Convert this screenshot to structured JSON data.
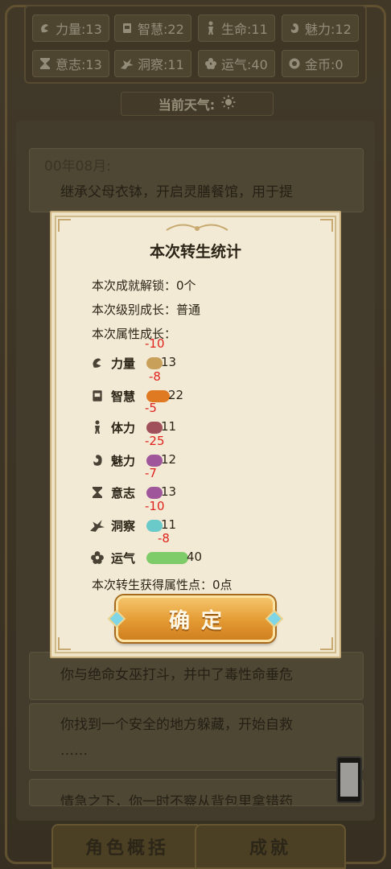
{
  "stats": [
    {
      "icon": "strength-icon",
      "label": "力量:13"
    },
    {
      "icon": "wisdom-icon",
      "label": "智慧:22"
    },
    {
      "icon": "life-icon",
      "label": "生命:11"
    },
    {
      "icon": "charm-icon",
      "label": "魅力:12"
    },
    {
      "icon": "will-icon",
      "label": "意志:13"
    },
    {
      "icon": "insight-icon",
      "label": "洞察:11"
    },
    {
      "icon": "luck-icon",
      "label": "运气:40"
    },
    {
      "icon": "coin-icon",
      "label": "金币:0"
    }
  ],
  "weather": {
    "label": "当前天气:",
    "icon": "sun-icon"
  },
  "log": {
    "card1_date": "00年08月:",
    "card1_text": "继承父母衣钵，开启灵膳餐馆，用于提",
    "card2_text": "你与绝命女巫打斗，并中了毒性命垂危",
    "card3_text": "你找到一个安全的地方躲藏，开始自救",
    "card3_more": "……",
    "card4_text": "情急之下，你一时不察从背包里拿错药"
  },
  "bottom_tabs": {
    "overview": "角色概括",
    "achievements": "成就"
  },
  "modal": {
    "title": "本次转生统计",
    "achievements_line": "本次成就解锁：0个",
    "level_line": "本次级别成长：普通",
    "attr_heading": "本次属性成长：",
    "attributes": [
      {
        "name": "力量",
        "icon": "strength-icon",
        "value": "13",
        "delta": "-10",
        "color": "#c9a05a",
        "level": 13
      },
      {
        "name": "智慧",
        "icon": "wisdom-icon",
        "value": "22",
        "delta": "-8",
        "color": "#e07a22",
        "level": 22
      },
      {
        "name": "体力",
        "icon": "stamina-icon",
        "value": "11",
        "delta": "-5",
        "color": "#a0505a",
        "level": 11
      },
      {
        "name": "魅力",
        "icon": "charm-icon",
        "value": "12",
        "delta": "-25",
        "color": "#a0569a",
        "level": 12
      },
      {
        "name": "意志",
        "icon": "will-icon",
        "value": "13",
        "delta": "-7",
        "color": "#a0569a",
        "level": 13
      },
      {
        "name": "洞察",
        "icon": "insight-icon",
        "value": "11",
        "delta": "-10",
        "color": "#6ac9c9",
        "level": 11
      },
      {
        "name": "运气",
        "icon": "luck-icon",
        "value": "40",
        "delta": "-8",
        "color": "#7ecb6a",
        "level": 40
      }
    ],
    "points_line": "本次转生获得属性点：0点",
    "confirm": "确定"
  }
}
